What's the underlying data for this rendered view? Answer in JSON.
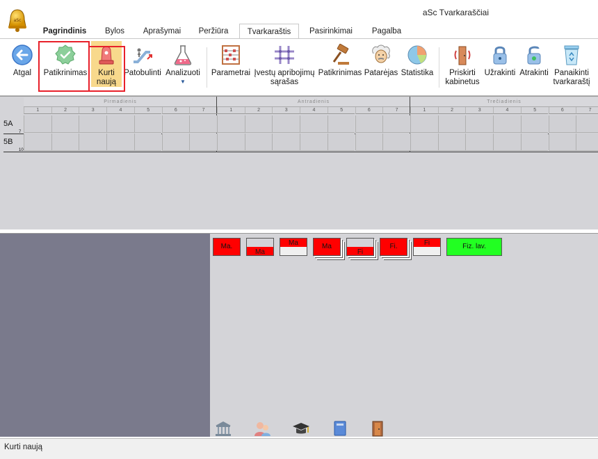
{
  "window": {
    "title": "aSc Tvarkaraščiai"
  },
  "tabs": [
    {
      "label": "Pagrindinis"
    },
    {
      "label": "Bylos"
    },
    {
      "label": "Aprašymai"
    },
    {
      "label": "Peržiūra"
    },
    {
      "label": "Tvarkaraštis"
    },
    {
      "label": "Pasirinkimai"
    },
    {
      "label": "Pagalba"
    }
  ],
  "ribbon": {
    "back": "Atgal",
    "check": "Patikrinimas",
    "create_new_l1": "Kurti",
    "create_new_l2": "naują",
    "improve": "Patobulinti",
    "analyze": "Analizuoti",
    "params": "Parametrai",
    "constraints_l1": "Įvestų apribojimų",
    "constraints_l2": "sąrašas",
    "checks": "Patikrinimas",
    "advisor": "Patarėjas",
    "stats": "Statistika",
    "assign_rooms_l1": "Priskirti",
    "assign_rooms_l2": "kabinetus",
    "lock": "Užrakinti",
    "unlock": "Atrakinti",
    "delete_tt_l1": "Panaikinti",
    "delete_tt_l2": "tvarkaraštį"
  },
  "grid": {
    "days": [
      "Pirmadienis",
      "Antradienis",
      "Trečiadienis"
    ],
    "periods": [
      "1",
      "2",
      "3",
      "4",
      "5",
      "6",
      "7"
    ],
    "rows": [
      {
        "name": "5A",
        "count": "7"
      },
      {
        "name": "5B",
        "count": "10"
      }
    ]
  },
  "cards": [
    {
      "label": "Ma."
    },
    {
      "label": "Ma"
    },
    {
      "label": "Ma"
    },
    {
      "label": "Ma"
    },
    {
      "label": "Fi"
    },
    {
      "label": "Fi."
    },
    {
      "label": "Fi"
    },
    {
      "label": "Fiz. lav."
    }
  ],
  "colors": {
    "card_red": "#ff0000",
    "card_green": "#22ff22",
    "highlight": "#f8d98c",
    "annotation": "#e8202a"
  },
  "icons": [
    "building-icon",
    "teachers-icon",
    "graduation-cap-icon",
    "book-icon",
    "door-icon"
  ],
  "status": {
    "text": "Kurti naują"
  }
}
